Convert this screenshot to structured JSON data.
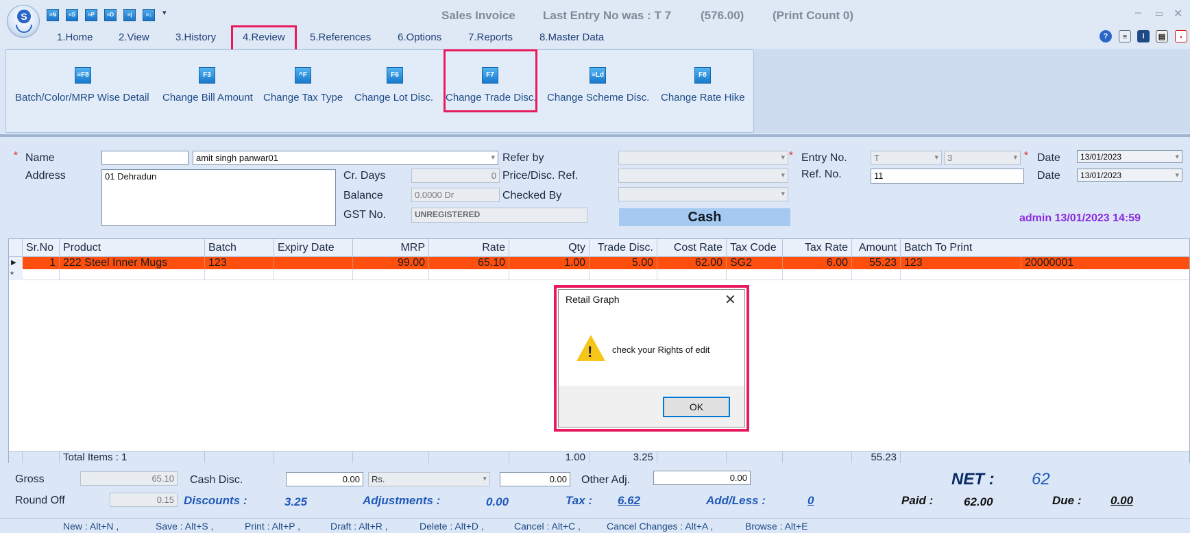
{
  "window": {
    "title": "Sales Invoice",
    "last_entry": "Last Entry No was : T 7",
    "last_amount": "(576.00)",
    "print_count": "(Print Count 0)"
  },
  "quick_access": [
    "≡N",
    "≡S",
    "≡P",
    "≡D",
    "≡|",
    "≡↓"
  ],
  "menu": [
    "1.Home",
    "2.View",
    "3.History",
    "4.Review",
    "5.References",
    "6.Options",
    "7.Reports",
    "8.Master Data"
  ],
  "ribbon": {
    "buttons": [
      {
        "icon": "≡F8",
        "label": "Batch/Color/MRP Wise Detail"
      },
      {
        "icon": "F3",
        "label": "Change Bill Amount"
      },
      {
        "icon": "^F",
        "label": "Change Tax Type"
      },
      {
        "icon": "F6",
        "label": "Change Lot Disc."
      },
      {
        "icon": "F7",
        "label": "Change Trade Disc."
      },
      {
        "icon": "≡Ld",
        "label": "Change Scheme Disc."
      },
      {
        "icon": "F8",
        "label": "Change Rate Hike"
      }
    ]
  },
  "form": {
    "name_label": "Name",
    "name_code": "",
    "name_value": "amit singh panwar01",
    "address_label": "Address",
    "address_value": "01 Dehradun",
    "cr_days_label": "Cr. Days",
    "cr_days_value": "0",
    "balance_label": "Balance",
    "balance_value": "0.0000 Dr",
    "gst_label": "GST No.",
    "gst_value": "UNREGISTERED",
    "refer_by_label": "Refer by",
    "price_disc_label": "Price/Disc. Ref.",
    "checked_by_label": "Checked By",
    "cash_label": "Cash",
    "entry_no_label": "Entry No.",
    "entry_series": "T",
    "entry_number": "3",
    "ref_no_label": "Ref. No.",
    "ref_no_value": "11",
    "date_label": "Date",
    "date1": "13/01/2023",
    "date2": "13/01/2023",
    "user_stamp": "admin 13/01/2023 14:59",
    "required_mark": "*"
  },
  "grid": {
    "columns": [
      "Sr.No",
      "Product",
      "Batch",
      "Expiry Date",
      "MRP",
      "Rate",
      "Qty",
      "Trade Disc.",
      "Cost Rate",
      "Tax Code",
      "Tax Rate",
      "Amount",
      "Batch To Print"
    ],
    "row": {
      "srno": "1",
      "product": "222 Steel Inner Mugs",
      "batch": "123",
      "expiry": "",
      "mrp": "99.00",
      "rate": "65.10",
      "qty": "1.00",
      "trade_disc": "5.00",
      "cost_rate": "62.00",
      "tax_code": "SG2",
      "tax_rate": "6.00",
      "amount": "55.23",
      "batch_to_print": "123",
      "batch_code": "20000001"
    },
    "totals": {
      "label": "Total Items : 1",
      "qty": "1.00",
      "trade_disc": "3.25",
      "amount": "55.23"
    }
  },
  "summary": {
    "gross_label": "Gross",
    "gross_value": "65.10",
    "round_off_label": "Round Off",
    "round_off_value": "0.15",
    "cash_disc_label": "Cash Disc.",
    "cash_disc_value": "0.00",
    "cash_disc_type": "Rs.",
    "cash_disc_amount": "0.00",
    "other_adj_label": "Other Adj.",
    "other_adj_value": "0.00",
    "discounts_label": "Discounts :",
    "discounts_value": "3.25",
    "adjustments_label": "Adjustments :",
    "adjustments_value": "0.00",
    "tax_label": "Tax :",
    "tax_value": "6.62",
    "addless_label": "Add/Less :",
    "addless_value": "0",
    "net_label": "NET :",
    "net_value": "62",
    "paid_label": "Paid :",
    "paid_value": "62.00",
    "due_label": "Due :",
    "due_value": "0.00"
  },
  "shortcuts": [
    "New : Alt+N ,",
    "Save : Alt+S ,",
    "Print : Alt+P ,",
    "Draft : Alt+R ,",
    "Delete : Alt+D ,",
    "Cancel : Alt+C ,",
    "Cancel Changes : Alt+A ,",
    "Browse : Alt+E"
  ],
  "dialog": {
    "title": "Retail Graph",
    "message": "check your Rights of edit",
    "ok": "OK"
  },
  "colors": {
    "accent": "#e8195d",
    "row_highlight": "#ff4f0f",
    "cash_box": "#a6c9f1"
  }
}
